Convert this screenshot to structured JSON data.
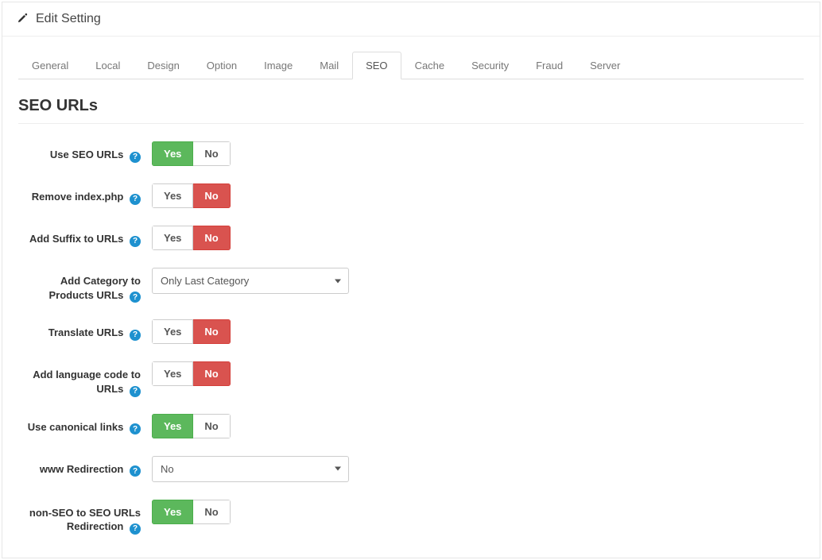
{
  "header": {
    "title": "Edit Setting"
  },
  "tabs": [
    {
      "label": "General"
    },
    {
      "label": "Local"
    },
    {
      "label": "Design"
    },
    {
      "label": "Option"
    },
    {
      "label": "Image"
    },
    {
      "label": "Mail"
    },
    {
      "label": "SEO",
      "active": true
    },
    {
      "label": "Cache"
    },
    {
      "label": "Security"
    },
    {
      "label": "Fraud"
    },
    {
      "label": "Server"
    }
  ],
  "section_title": "SEO URLs",
  "yes_label": "Yes",
  "no_label": "No",
  "help_glyph": "?",
  "fields": {
    "use_seo_urls": {
      "label": "Use SEO URLs",
      "value": "yes"
    },
    "remove_index_php": {
      "label": "Remove index.php",
      "value": "no"
    },
    "add_suffix": {
      "label": "Add Suffix to URLs",
      "value": "no"
    },
    "add_category": {
      "label": "Add Category to Products URLs",
      "selected": "Only Last Category"
    },
    "translate_urls": {
      "label": "Translate URLs",
      "value": "no"
    },
    "add_lang_code": {
      "label": "Add language code to URLs",
      "value": "no"
    },
    "use_canonical": {
      "label": "Use canonical links",
      "value": "yes"
    },
    "www_redirection": {
      "label": "www Redirection",
      "selected": "No"
    },
    "nonseo_redirect": {
      "label": "non-SEO to SEO URLs Redirection",
      "value": "yes"
    }
  }
}
